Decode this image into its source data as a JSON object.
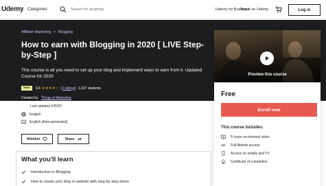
{
  "header": {
    "logo": "Udemy",
    "categories": "Categories",
    "search_placeholder": "Search for anything",
    "business_link": "Udemy for Business",
    "teach_link": "Teach on Udemy",
    "login": "Log in"
  },
  "breadcrumb": {
    "items": [
      "Affiliate Marketing",
      "Blogging"
    ]
  },
  "course": {
    "title": "How to earn with Blogging in 2020 [ LIVE Step-by-Step ]",
    "subtitle": "This course is all you need to set up your blog and implement ways to earn from it. Updated Course for 2020",
    "badge": "New",
    "rating": "3.6",
    "stars": "★★★★☆",
    "ratings_count": "(2 ratings)",
    "students": "1,027 students",
    "created_by_label": "Created by",
    "author": "Things of Marketing",
    "last_updated": "Last updated 2/2020",
    "language": "English",
    "captions": "English [Auto-generated]"
  },
  "actions": {
    "wishlist": "Wishlist",
    "share": "Share"
  },
  "learn": {
    "title": "What you'll learn",
    "items": [
      "Introduction to Blogging",
      "How to create your blog or website with step-by-step demo"
    ]
  },
  "sidebar": {
    "preview_label": "Preview this course",
    "price": "Free",
    "enroll": "Enroll now",
    "includes_title": "This course includes:",
    "includes": [
      "5 hours on-demand video",
      "Full lifetime access",
      "Access on mobile and TV",
      "Certificate of completion"
    ]
  },
  "colors": {
    "banner_bg": "#1c1d1f",
    "link_purple": "#cec0fc",
    "star": "#e59819",
    "enroll": "#e65a4f",
    "badge_bg": "#eceb98"
  }
}
